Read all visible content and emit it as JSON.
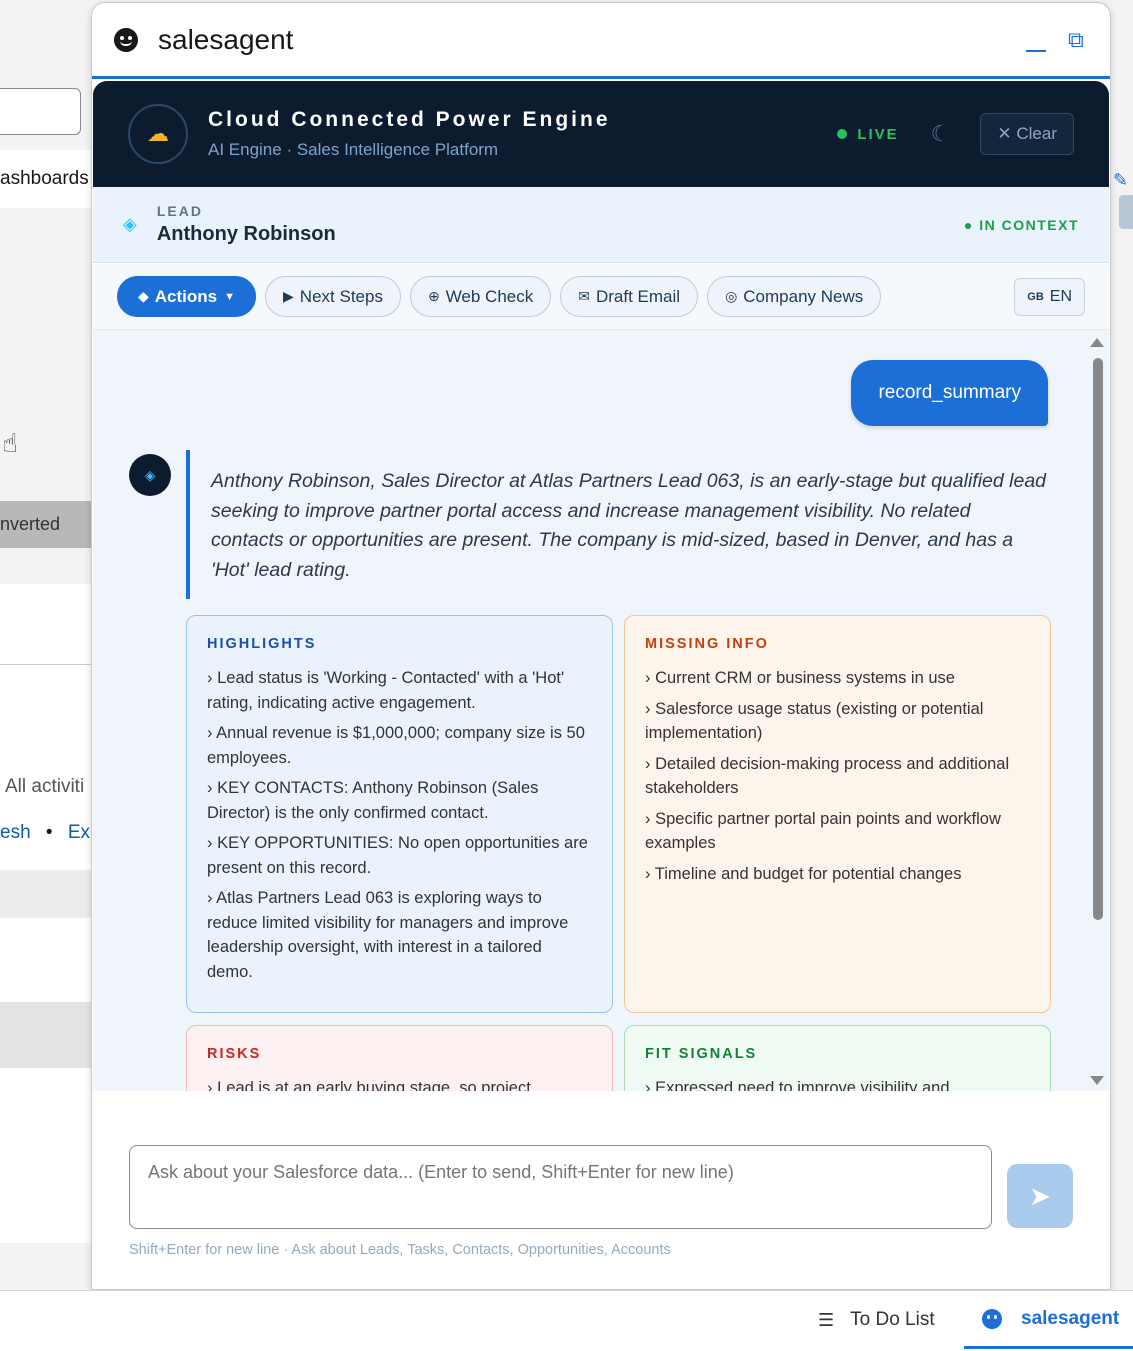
{
  "background": {
    "nav_label": "ashboards",
    "status_label": "nverted",
    "activity_label": "All activiti",
    "links": {
      "refresh": "esh",
      "expand": "Exp"
    }
  },
  "panel": {
    "title": "salesagent",
    "icons": {
      "bot": "smiley-icon",
      "minimize": "minimize-icon",
      "popout": "popout-icon"
    }
  },
  "engine": {
    "title": "Cloud Connected Power Engine",
    "subtitle": "AI Engine · Sales Intelligence Platform",
    "live_label": "LIVE",
    "clear_label": "Clear",
    "logo_icon": "cloud-icon",
    "theme_icon": "moon-icon"
  },
  "lead": {
    "label": "LEAD",
    "name": "Anthony Robinson",
    "context_label": "IN CONTEXT"
  },
  "actions": {
    "primary_label": "Actions",
    "buttons": [
      "Next Steps",
      "Web Check",
      "Draft Email",
      "Company News"
    ],
    "language_flag": "GB",
    "language_label": "EN"
  },
  "chat": {
    "user_message": "record_summary",
    "summary": "Anthony Robinson, Sales Director at Atlas Partners Lead 063, is an early-stage but qualified lead seeking to improve partner portal access and increase management visibility. No related contacts or opportunities are present. The company is mid-sized, based in Denver, and has a 'Hot' lead rating.",
    "highlights": {
      "title": "HIGHLIGHTS",
      "items": [
        "Lead status is 'Working - Contacted' with a 'Hot' rating, indicating active engagement.",
        "Annual revenue is $1,000,000; company size is 50 employees.",
        "KEY CONTACTS: Anthony Robinson (Sales Director) is the only confirmed contact.",
        "KEY OPPORTUNITIES: No open opportunities are present on this record.",
        "Atlas Partners Lead 063 is exploring ways to reduce limited visibility for managers and improve leadership oversight, with interest in a tailored demo."
      ]
    },
    "missing_info": {
      "title": "MISSING INFO",
      "items": [
        "Current CRM or business systems in use",
        "Salesforce usage status (existing or potential implementation)",
        "Detailed decision-making process and additional stakeholders",
        "Specific partner portal pain points and workflow examples",
        "Timeline and budget for potential changes"
      ]
    },
    "risks": {
      "title": "RISKS",
      "items": [
        "Lead is at an early buying stage, so project urgency"
      ]
    },
    "fit_signals": {
      "title": "FIT SIGNALS",
      "items": [
        "Expressed need to improve visibility and"
      ]
    }
  },
  "input": {
    "placeholder": "Ask about your Salesforce data... (Enter to send, Shift+Enter for new line)",
    "hint": "Shift+Enter for new line · Ask about Leads, Tasks, Contacts, Opportunities, Accounts"
  },
  "utility_bar": {
    "todo_label": "To Do List",
    "salesagent_label": "salesagent"
  }
}
